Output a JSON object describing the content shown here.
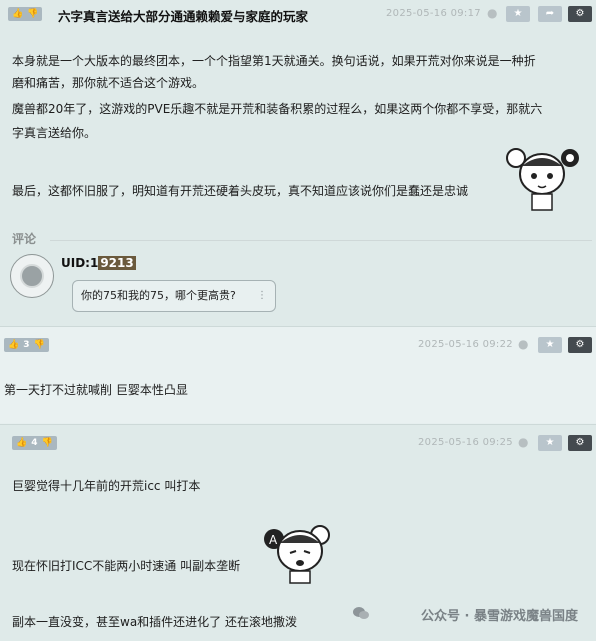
{
  "colors": {
    "accent": "#aab8c0",
    "dark_button": "#444a4f",
    "uid_highlight": "#6b5a3d"
  },
  "post1": {
    "vote_icons": [
      "thumb-up-icon",
      "thumb-down-icon"
    ],
    "title": "六字真言送给大部分通通赖赖爱与家庭的玩家",
    "timestamp": "2025-05-16 09:17",
    "paragraphs": [
      "本身就是一个大版本的最终团本，一个个指望第1天就通关。换句话说，如果开荒对你来说是一种折",
      "磨和痛苦，那你就不适合这个游戏。",
      "魔兽都20年了，这游戏的PVE乐趣不就是开荒和装备积累的过程么，如果这两个你都不享受，那就六",
      "字真言送给你。",
      "最后，这都怀旧服了，明知道有开荒还硬着头皮玩，真不知道应该说你们是蠢还是忠诚"
    ],
    "comments_label": "评论",
    "comment": {
      "uid_prefix": "UID:1",
      "uid_highlight": "9213",
      "text": "你的75和我的75，哪个更高贵?",
      "more": "⋮"
    }
  },
  "post2": {
    "votes": "3",
    "timestamp": "2025-05-16 09:22",
    "text": "第一天打不过就喊削 巨婴本性凸显"
  },
  "post3": {
    "votes": "4",
    "timestamp": "2025-05-16 09:25",
    "lines": [
      "巨婴觉得十几年前的开荒icc 叫打本",
      "现在怀旧打ICC不能两小时速通 叫副本垄断",
      "副本一直没变，甚至wa和插件还进化了 还在滚地撒泼"
    ]
  },
  "watermark": "公众号 · 暴雪游戏魔兽国度"
}
